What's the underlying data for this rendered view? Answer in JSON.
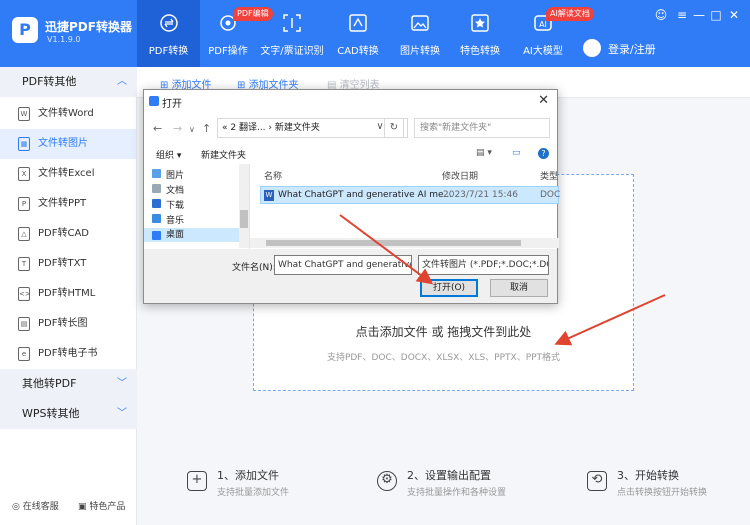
{
  "app": {
    "name": "迅捷PDF转换器",
    "version": "V1.1.9.0"
  },
  "nav": {
    "tabs": [
      "PDF转换",
      "PDF操作",
      "文字/票证识别",
      "CAD转换",
      "图片转换",
      "特色转换",
      "AI大模型"
    ],
    "badges": {
      "pdf_edit": "PDF编辑",
      "ai_doc": "AI解读文档"
    },
    "login": "登录/注册"
  },
  "colors": {
    "brand": "#2f7cf6",
    "badge": "#f0413d",
    "arrow": "#e0442e"
  },
  "sidebar": {
    "group1": "PDF转其他",
    "items": [
      "文件转Word",
      "文件转图片",
      "文件转Excel",
      "文件转PPT",
      "PDF转CAD",
      "PDF转TXT",
      "PDF转HTML",
      "PDF转长图",
      "PDF转电子书"
    ],
    "group2": "其他转PDF",
    "group3": "WPS转其他",
    "footer": {
      "online": "在线客服",
      "featured": "特色产品"
    }
  },
  "toolbar": {
    "add_file": "添加文件",
    "add_folder": "添加文件夹",
    "clear": "清空列表"
  },
  "dropzone": {
    "title": "点击添加文件 或 拖拽文件到此处",
    "formats": "支持PDF、DOC、DOCX、XLSX、XLS、PPTX、PPT格式"
  },
  "steps": [
    {
      "title": "1、添加文件",
      "desc": "支持批量添加文件"
    },
    {
      "title": "2、设置输出配置",
      "desc": "支持批量操作和各种设置"
    },
    {
      "title": "3、开始转换",
      "desc": "点击转换按钮开始转换"
    }
  ],
  "dialog": {
    "title": "打开",
    "path": "«  2 翻译...  ›  新建文件夹",
    "search_placeholder": "搜索\"新建文件夹\"",
    "organize": "组织 ▾",
    "new_folder": "新建文件夹",
    "tree": [
      "图片",
      "文档",
      "下载",
      "音乐",
      "桌面"
    ],
    "columns": {
      "name": "名称",
      "modified": "修改日期",
      "type": "类型"
    },
    "file": {
      "name": "What ChatGPT and generative AI me...",
      "modified": "2023/7/21 15:46",
      "type": "DOC"
    },
    "filename_label": "文件名(N):",
    "filename_value": "What ChatGPT and generative",
    "filetype": "文件转图片 (*.PDF;*.DOC;*.DC",
    "open": "打开(O)",
    "cancel": "取消"
  }
}
